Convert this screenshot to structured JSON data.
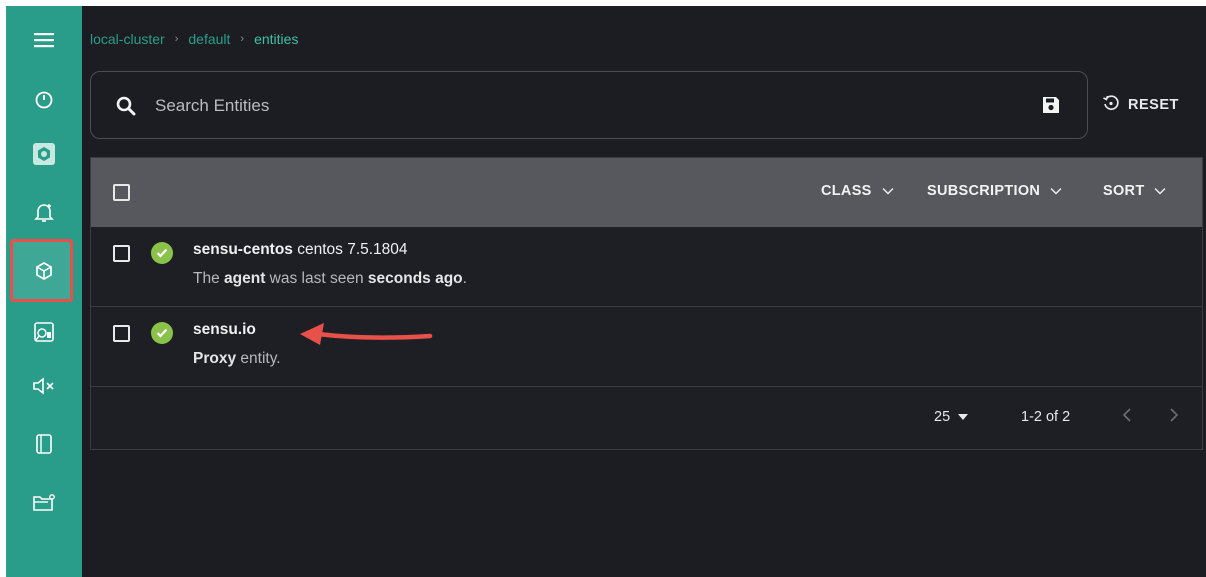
{
  "breadcrumb": {
    "items": [
      "local-cluster",
      "default",
      "entities"
    ],
    "separator": "›"
  },
  "search": {
    "placeholder": "Search Entities",
    "reset_label": "RESET"
  },
  "sidebar": {
    "items": [
      "menu-icon",
      "dashboard-icon",
      "checks-icon",
      "events-icon",
      "entities-icon",
      "filters-icon",
      "silences-icon",
      "handlers-icon",
      "mutators-icon"
    ],
    "active": "entities-icon"
  },
  "table": {
    "filters": [
      "CLASS",
      "SUBSCRIPTION",
      "SORT"
    ],
    "rows": [
      {
        "name": "sensu-centos",
        "os": "centos 7.5.1804",
        "d1": "The ",
        "d2": "agent",
        "d3": " was last seen ",
        "d4": "seconds ago",
        "d5": "."
      },
      {
        "name": "sensu.io",
        "os": "",
        "d1": "",
        "d2": "Proxy",
        "d3": " entity.",
        "d4": "",
        "d5": ""
      }
    ],
    "page_size": "25",
    "page_info": "1-2 of 2"
  },
  "colors": {
    "sidebar": "#2a9d8a",
    "background": "#1c1d22",
    "header": "#56585e",
    "status_ok": "#8bc34a",
    "highlight": "#e8504a"
  }
}
